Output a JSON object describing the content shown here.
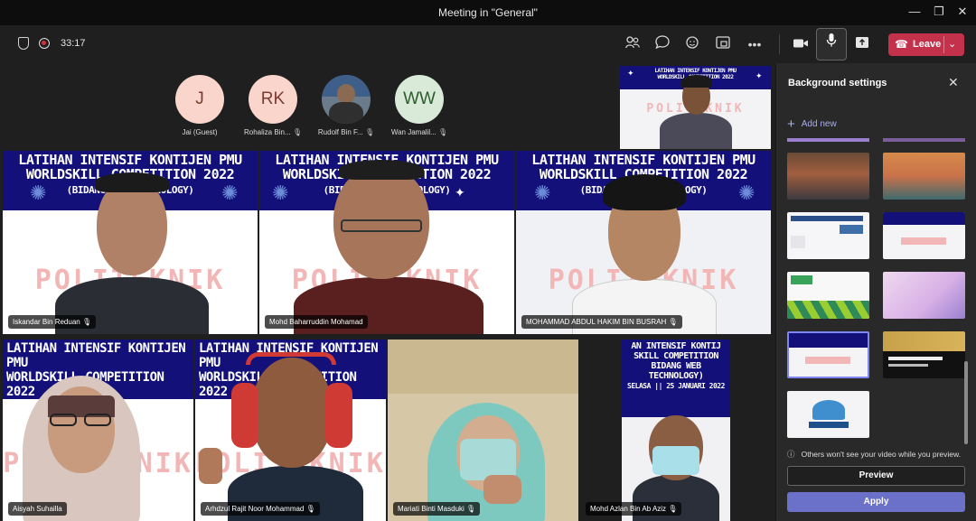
{
  "window": {
    "title": "Meeting in \"General\"",
    "minimize": "—",
    "maximize": "❐",
    "close": "✕"
  },
  "toolbar": {
    "timer": "33:17",
    "leave_label": "Leave"
  },
  "participants_bar": [
    {
      "initials": "J",
      "name": "Jai (Guest)",
      "color": "#f9d5cc",
      "muted": false
    },
    {
      "initials": "RK",
      "name": "Rohaliza Bin...",
      "color": "#f9d5cc",
      "muted": true
    },
    {
      "initials": "",
      "name": "Rudolf Bin F...",
      "color": "#6a7b8c",
      "muted": true
    },
    {
      "initials": "WW",
      "name": "Wan Jamalil...",
      "color": "#d9ead9",
      "muted": true
    }
  ],
  "banner_text": {
    "line1": "LATIHAN INTENSIF KONTIJEN PMU",
    "line2": "WORLDSKILL COMPETITION 2022",
    "line3": "(BIDANG WEB TECHNOLOGY)",
    "brand": "POLITEKNIK"
  },
  "banner_text_r": {
    "line1": "AN INTENSIF KONTIJ",
    "line2": "SKILL COMPETITION",
    "line3": "BIDANG WEB TECHNOLOGY)",
    "line4": "SELASA || 25 JANUARI 2022"
  },
  "video_tiles": [
    {
      "name": "Iskandar Bin Reduan"
    },
    {
      "name": "Mohd Baharruddin Mohamad"
    },
    {
      "name": "MOHAMMAD ABDUL HAKIM BIN BUSRAH"
    },
    {
      "name": "Aisyah Suhailla"
    },
    {
      "name": "Arhdzul Rajit Noor Mohammad"
    },
    {
      "name": "Mariati Binti Masduki"
    },
    {
      "name": "Mohd Azlan Bin Ab Aziz"
    }
  ],
  "panel": {
    "title": "Background settings",
    "add_new": "Add new",
    "note": "Others won't see your video while you preview.",
    "preview": "Preview",
    "apply": "Apply"
  }
}
